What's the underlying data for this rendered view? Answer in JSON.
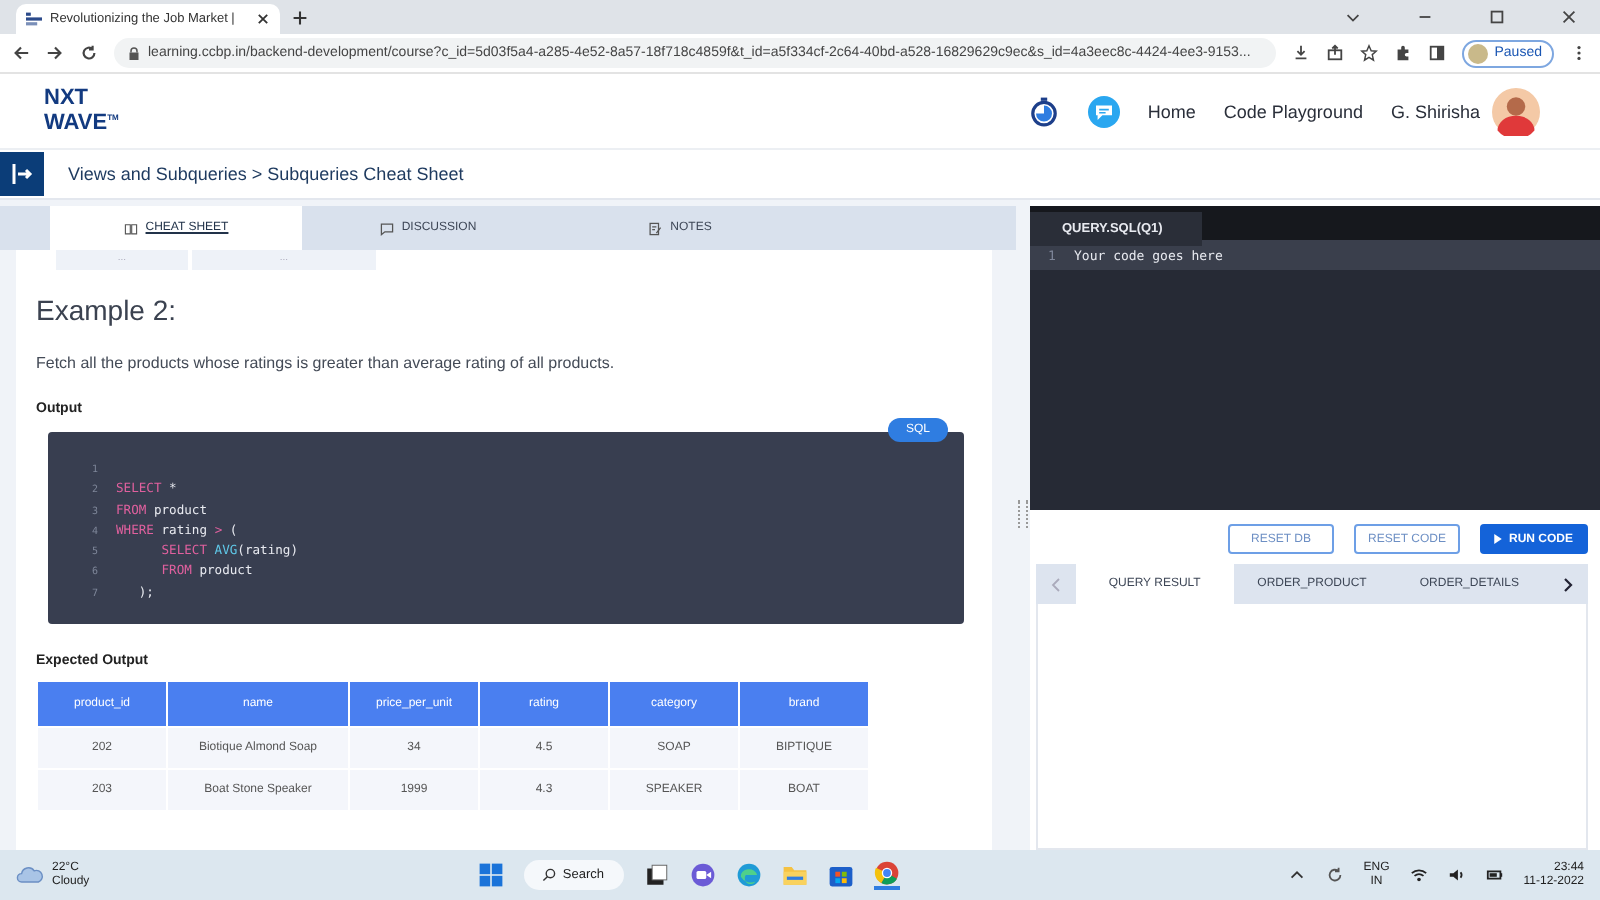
{
  "browser": {
    "tab_title": "Revolutionizing the Job Market |",
    "url": "learning.ccbp.in/backend-development/course?c_id=5d03f5a4-a285-4e52-8a57-18f718c4859f&t_id=a5f334cf-2c64-40bd-a528-16829629c9ec&s_id=4a3eec8c-4424-4ee3-9153...",
    "profile_status": "Paused"
  },
  "header": {
    "logo_top": "NXT",
    "logo_bottom": "WAVE",
    "logo_mark": "TM",
    "nav": [
      "Home",
      "Code Playground"
    ],
    "user_name": "G. Shirisha"
  },
  "breadcrumb": "Views and Subqueries > Subqueries Cheat Sheet",
  "tabs": [
    {
      "label": "CHEAT SHEET",
      "selected": true
    },
    {
      "label": "DISCUSSION",
      "selected": false
    },
    {
      "label": "NOTES",
      "selected": false
    }
  ],
  "partial_row": [
    "...",
    "..."
  ],
  "heading": "Example 2:",
  "description": "Fetch all the products whose ratings is greater than average rating of all products.",
  "output_label": "Output",
  "code_language": "SQL",
  "code_lines": [
    {
      "number": "1"
    },
    {
      "number": "2",
      "segments": [
        {
          "kind": "keyword",
          "text": "SELECT"
        },
        {
          "kind": "plain",
          "text": " *"
        }
      ]
    },
    {
      "number": "3",
      "segments": [
        {
          "kind": "keyword",
          "text": "FROM"
        },
        {
          "kind": "plain",
          "text": " product"
        }
      ]
    },
    {
      "number": "4",
      "segments": [
        {
          "kind": "keyword",
          "text": "WHERE"
        },
        {
          "kind": "plain",
          "text": " rating "
        },
        {
          "kind": "keyword",
          "text": ">"
        },
        {
          "kind": "plain",
          "text": " ("
        }
      ]
    },
    {
      "number": "5",
      "segments": [
        {
          "kind": "keyword",
          "text": "      SELECT "
        },
        {
          "kind": "function",
          "text": "AVG"
        },
        {
          "kind": "plain",
          "text": "(rating)"
        }
      ]
    },
    {
      "number": "6",
      "segments": [
        {
          "kind": "keyword",
          "text": "      FROM"
        },
        {
          "kind": "plain",
          "text": " product"
        }
      ]
    },
    {
      "number": "7",
      "segments": [
        {
          "kind": "plain",
          "text": "   );"
        }
      ]
    }
  ],
  "expected_label": "Expected Output",
  "table": {
    "columns": [
      "product_id",
      "name",
      "price_per_unit",
      "rating",
      "category",
      "brand"
    ],
    "rows": [
      [
        "202",
        "Biotique Almond Soap",
        "34",
        "4.5",
        "SOAP",
        "BIPTIQUE"
      ],
      [
        "203",
        "Boat Stone Speaker",
        "1999",
        "4.3",
        "SPEAKER",
        "BOAT"
      ]
    ]
  },
  "editor": {
    "file_tab": "QUERY.SQL(Q1)",
    "lines": [
      {
        "number": "1",
        "text": "Your code goes here"
      }
    ],
    "buttons": [
      {
        "label": "RESET DB",
        "kind": "outline"
      },
      {
        "label": "RESET CODE",
        "kind": "outline"
      },
      {
        "label": "RUN CODE",
        "kind": "primary"
      }
    ],
    "result_tabs": [
      {
        "label": "QUERY RESULT",
        "selected": true
      },
      {
        "label": "ORDER_PRODUCT",
        "selected": false
      },
      {
        "label": "ORDER_DETAILS",
        "selected": false
      }
    ]
  },
  "taskbar": {
    "temperature": "22°C",
    "weather": "Cloudy",
    "search": "Search",
    "language": "ENG",
    "region": "IN",
    "time": "23:44",
    "date": "11-12-2022"
  }
}
